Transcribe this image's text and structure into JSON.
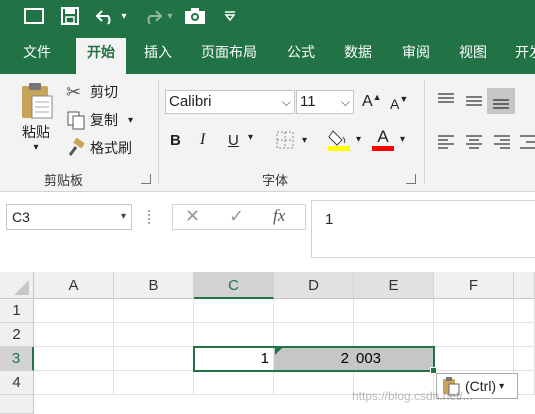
{
  "quick_access": {
    "icons": [
      "window-icon",
      "save-icon",
      "undo-icon",
      "redo-icon",
      "camera-icon",
      "customize-icon"
    ]
  },
  "tabs": [
    {
      "label": "文件",
      "active": false
    },
    {
      "label": "开始",
      "active": true
    },
    {
      "label": "插入",
      "active": false
    },
    {
      "label": "页面布局",
      "active": false
    },
    {
      "label": "公式",
      "active": false
    },
    {
      "label": "数据",
      "active": false
    },
    {
      "label": "审阅",
      "active": false
    },
    {
      "label": "视图",
      "active": false
    },
    {
      "label": "开发",
      "active": false
    }
  ],
  "clipboard": {
    "paste_label": "粘贴",
    "cut_label": "剪切",
    "copy_label": "复制",
    "format_painter_label": "格式刷",
    "group_label": "剪贴板"
  },
  "font": {
    "family": "Calibri",
    "size": "11",
    "bold": "B",
    "italic": "I",
    "underline": "U",
    "grow": "A",
    "shrink": "A",
    "font_color_letter": "A",
    "group_label": "字体",
    "fill_color": "#FFFF00",
    "text_color": "#FF0000"
  },
  "formula_bar": {
    "name_box": "C3",
    "cancel": "✕",
    "enter": "✓",
    "fx": "fx",
    "content": "1"
  },
  "sheet": {
    "columns": [
      "A",
      "B",
      "C",
      "D",
      "E",
      "F"
    ],
    "rows": [
      "1",
      "2",
      "3",
      "4"
    ],
    "selected_column": "C",
    "selected_row": "3",
    "cells": {
      "C3": "1",
      "D3": "2",
      "E3": "003"
    }
  },
  "paste_options": {
    "label": "(Ctrl)"
  },
  "watermark": "https://blog.csdn.net/...",
  "colors": {
    "brand": "#217346",
    "ribbon": "#F3F3F3",
    "selection_fill": "#C6C6C6"
  }
}
